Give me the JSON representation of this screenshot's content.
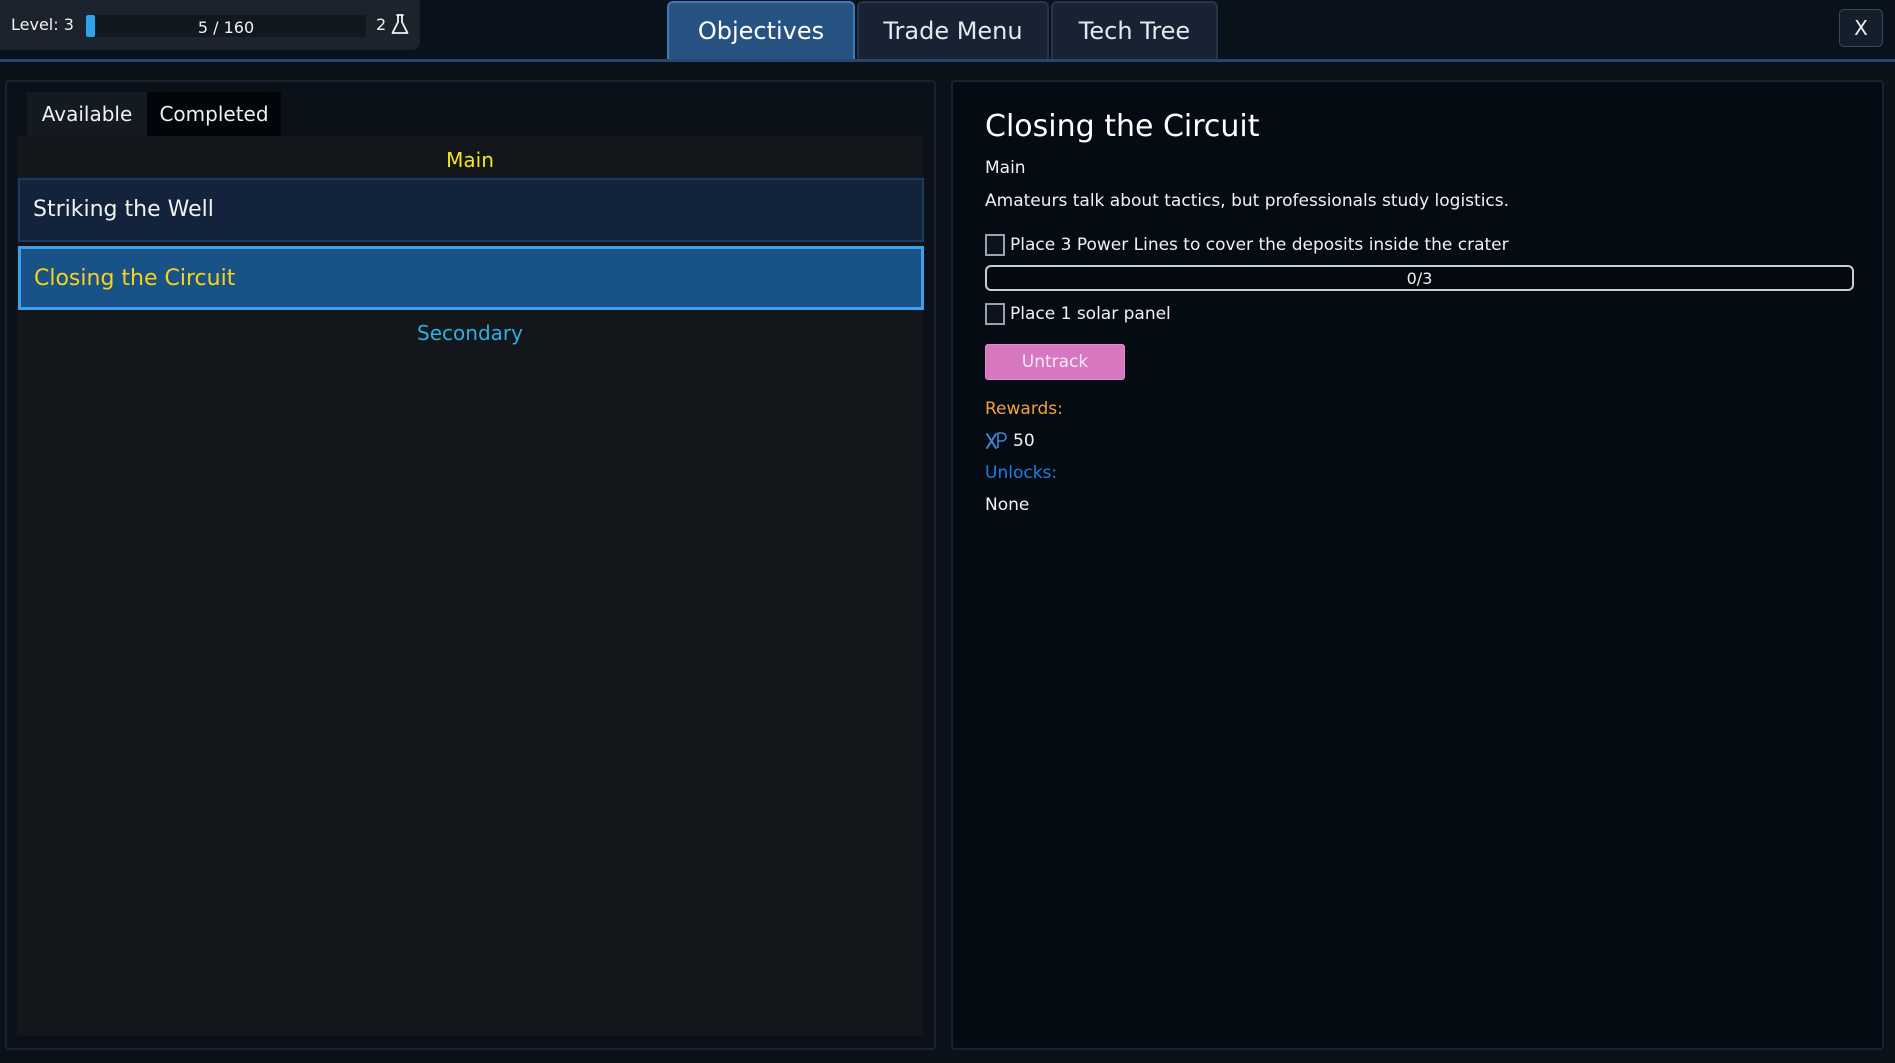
{
  "topbar": {
    "level_label": "Level: 3",
    "xp_text": "5 / 160",
    "xp_progress_fraction": 0.03125,
    "research_count": "2",
    "research_icon": "flask-icon"
  },
  "tabs": [
    {
      "label": "Objectives",
      "active": true
    },
    {
      "label": "Trade Menu",
      "active": false
    },
    {
      "label": "Tech Tree",
      "active": false
    }
  ],
  "close_label": "X",
  "left": {
    "subtabs": [
      {
        "label": "Available",
        "active": true
      },
      {
        "label": "Completed",
        "active": false
      }
    ],
    "main_heading": "Main",
    "objectives": [
      {
        "label": "Striking the Well",
        "selected": false
      },
      {
        "label": "Closing the Circuit",
        "selected": true
      }
    ],
    "secondary_heading": "Secondary"
  },
  "detail": {
    "title": "Closing the Circuit",
    "category": "Main",
    "description": "Amateurs talk about tactics, but professionals study logistics.",
    "tasks": [
      {
        "text": "Place 3 Power Lines to cover the deposits inside the crater",
        "checked": false
      },
      {
        "text": "Place 1 solar panel",
        "checked": false
      }
    ],
    "progress_text": "0/3",
    "progress_value": 0,
    "progress_max": 3,
    "untrack_label": "Untrack",
    "rewards_label": "Rewards:",
    "reward_xp_icon": "xp-icon",
    "reward_xp_value": "50",
    "unlocks_label": "Unlocks:",
    "unlocks_value": "None"
  },
  "colors": {
    "accent_blue": "#2ea3e8",
    "main_heading": "#f5e616",
    "secondary_heading": "#2db0e0",
    "selected_item_text": "#f7d31a",
    "untrack_button": "#d777c0",
    "rewards_label": "#f3a13b",
    "unlocks_label": "#1e7de6"
  }
}
